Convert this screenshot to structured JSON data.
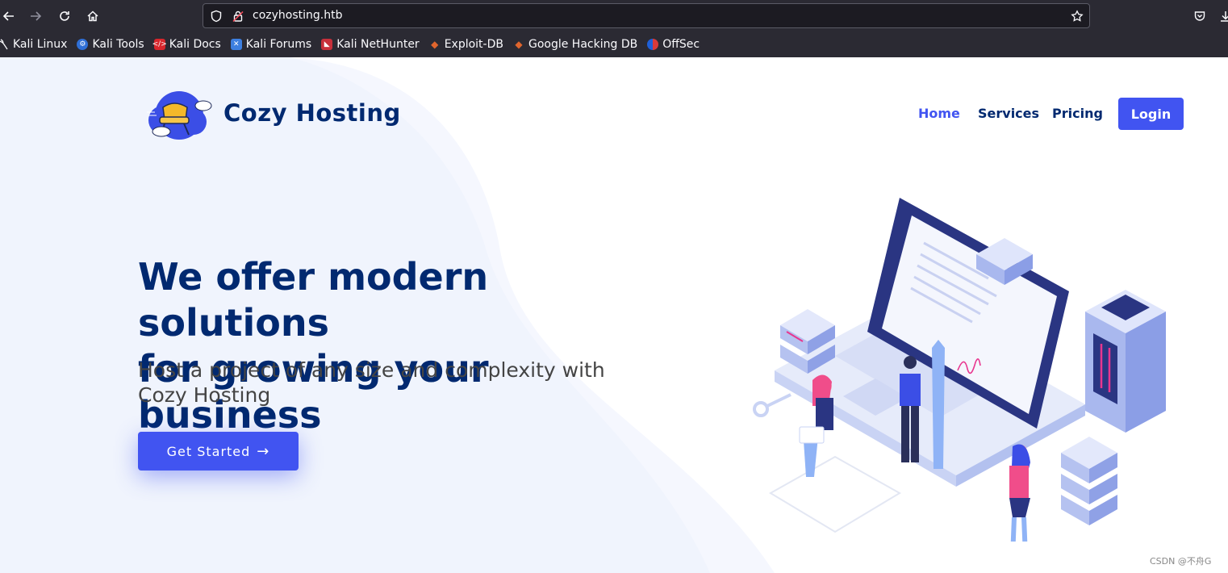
{
  "browser": {
    "url": "cozyhosting.htb",
    "bookmarks": [
      {
        "label": "Kali Linux",
        "icon": "kali-dragon-icon"
      },
      {
        "label": "Kali Tools",
        "icon": "kali-tools-icon"
      },
      {
        "label": "Kali Docs",
        "icon": "kali-docs-icon"
      },
      {
        "label": "Kali Forums",
        "icon": "kali-forums-icon"
      },
      {
        "label": "Kali NetHunter",
        "icon": "kali-nethunter-icon"
      },
      {
        "label": "Exploit-DB",
        "icon": "exploit-db-icon"
      },
      {
        "label": "Google Hacking DB",
        "icon": "ghdb-icon"
      },
      {
        "label": "OffSec",
        "icon": "offsec-icon"
      }
    ]
  },
  "site": {
    "brand": "Cozy Hosting",
    "nav": {
      "home": "Home",
      "services": "Services",
      "pricing": "Pricing",
      "login": "Login"
    },
    "hero": {
      "line1": "We offer modern solutions",
      "line2": "for growing your business",
      "subtitle": "Host a project of any size and complexity with Cozy Hosting",
      "cta": "Get Started",
      "cta_arrow": "→"
    }
  },
  "watermark": "CSDN @不舟G",
  "colors": {
    "primary": "#4154f1",
    "navy": "#012970",
    "chrome_bg": "#2b2a33",
    "hero_bg": "#f3f6fe"
  }
}
